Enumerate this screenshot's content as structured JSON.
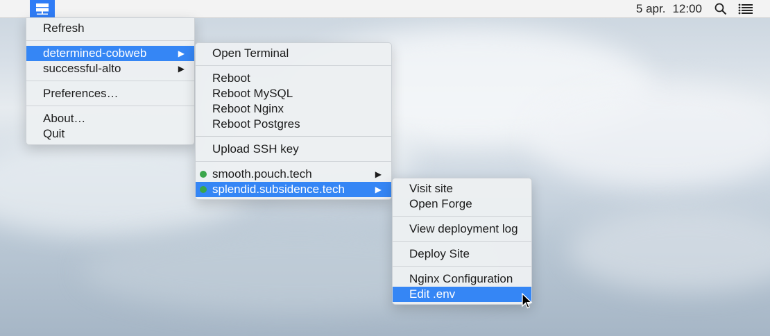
{
  "menubar": {
    "date": "5 apr.",
    "time": "12:00",
    "app_icon": "server-icon",
    "search_icon": "search-icon",
    "notifications_icon": "list-icon"
  },
  "main_menu": {
    "items": [
      "Refresh",
      "determined-cobweb",
      "successful-alto",
      "Preferences…",
      "About…",
      "Quit"
    ],
    "selected": "determined-cobweb",
    "submenu_arrow": "▶"
  },
  "server_menu": {
    "items": [
      "Open Terminal",
      "Reboot",
      "Reboot MySQL",
      "Reboot Nginx",
      "Reboot Postgres",
      "Upload SSH key",
      "smooth.pouch.tech",
      "splendid.subsidence.tech"
    ],
    "selected": "splendid.subsidence.tech",
    "status_color": "#3aa64b"
  },
  "site_menu": {
    "items": [
      "Visit site",
      "Open Forge",
      "View deployment log",
      "Deploy Site",
      "Nginx Configuration",
      "Edit .env"
    ],
    "selected": "Edit .env"
  },
  "colors": {
    "selection": "#3586f5",
    "menubar": "#f3f3f3"
  }
}
